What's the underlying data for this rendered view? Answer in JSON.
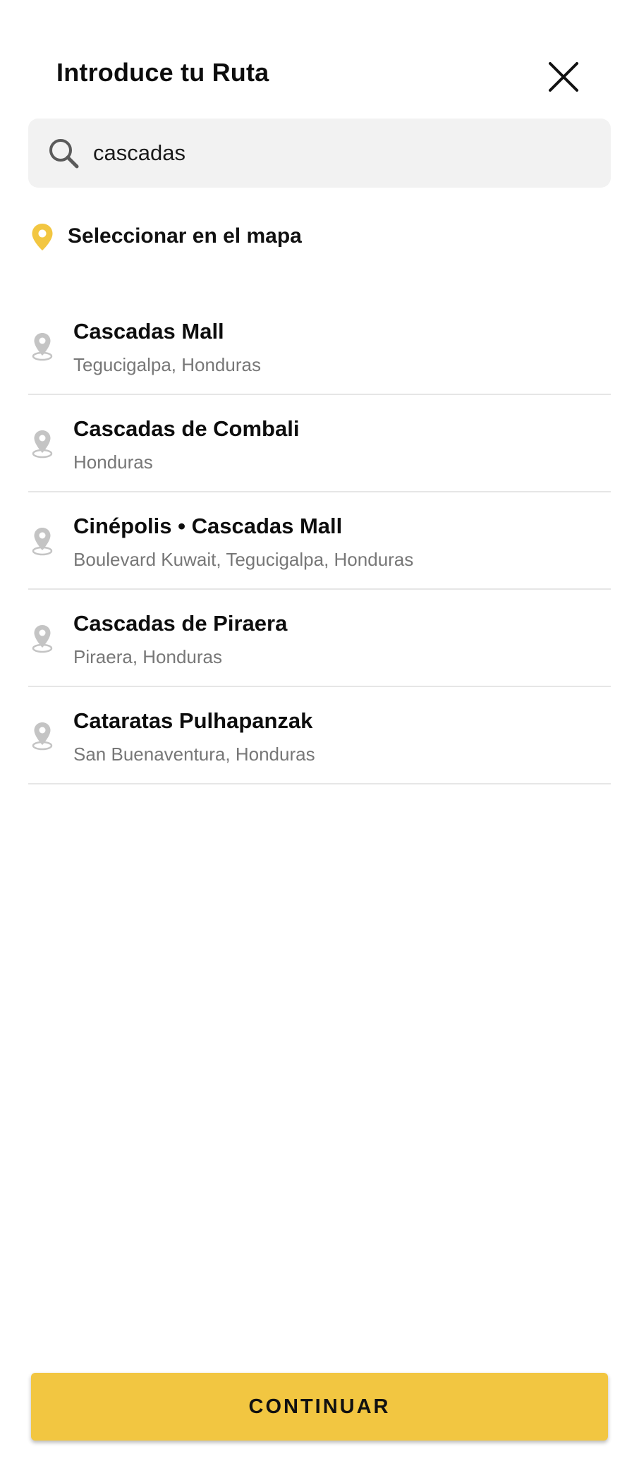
{
  "header": {
    "title": "Introduce tu Ruta",
    "close_icon": "close-icon"
  },
  "search": {
    "value": "cascadas",
    "placeholder": "",
    "icon": "search-icon"
  },
  "select_on_map": {
    "label": "Seleccionar en el mapa",
    "icon": "map-pin-icon",
    "color": "#f2c641"
  },
  "results": [
    {
      "name": "Cascadas Mall",
      "address": "Tegucigalpa, Honduras"
    },
    {
      "name": "Cascadas de Combali",
      "address": "Honduras"
    },
    {
      "name": "Cinépolis • Cascadas Mall",
      "address": "Boulevard Kuwait, Tegucigalpa, Honduras"
    },
    {
      "name": "Cascadas de Piraera",
      "address": "Piraera, Honduras"
    },
    {
      "name": "Cataratas Pulhapanzak",
      "address": "San Buenaventura, Honduras"
    }
  ],
  "footer": {
    "continue_label": "CONTINUAR"
  },
  "colors": {
    "accent": "#f2c641",
    "search_bg": "#f2f2f2",
    "secondary_text": "#777777",
    "result_pin": "#c4c4c4"
  }
}
